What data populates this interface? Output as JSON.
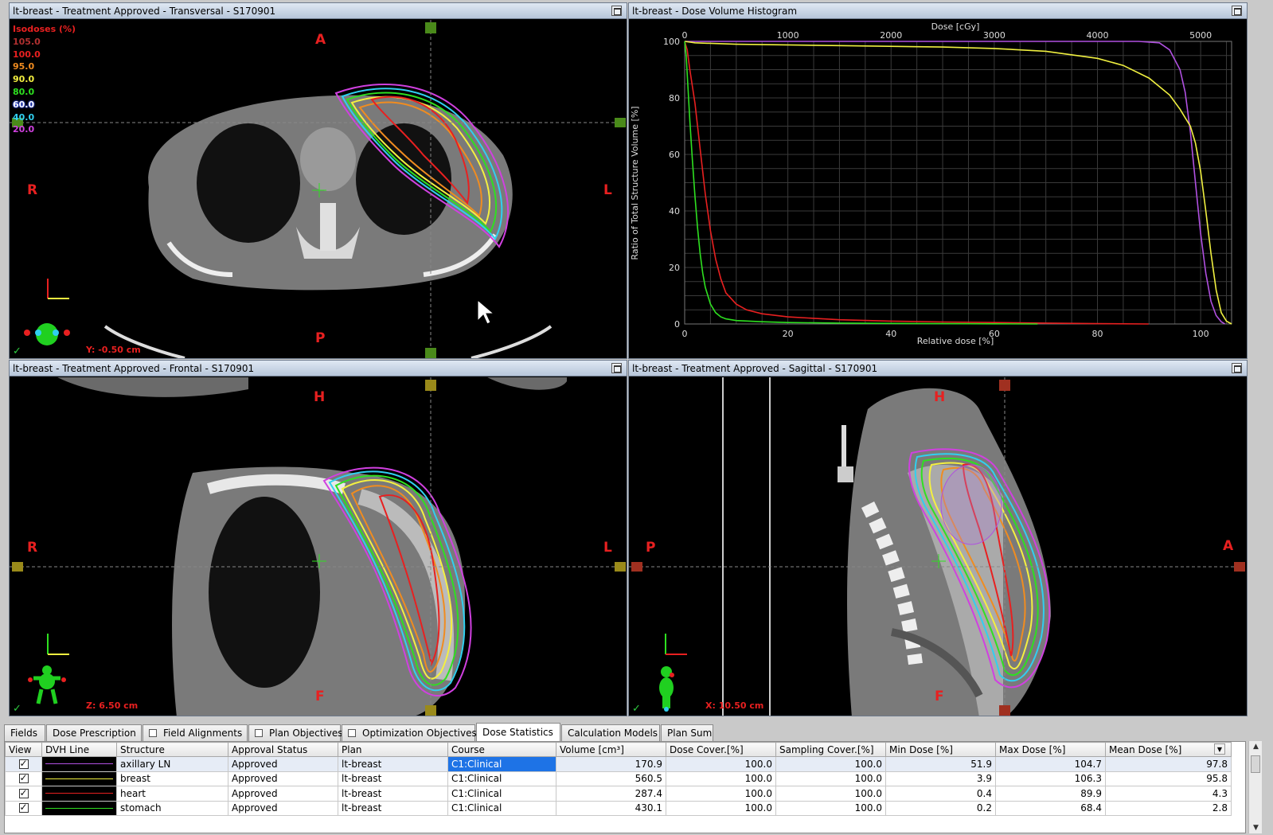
{
  "panes": {
    "transversal": {
      "title": "lt-breast - Treatment Approved - Transversal - S170901",
      "coord": "Y: -0.50 cm",
      "orient": {
        "top": "A",
        "bottom": "P",
        "left": "R",
        "right": "L"
      }
    },
    "dvh": {
      "title": "lt-breast - Dose Volume Histogram"
    },
    "frontal": {
      "title": "lt-breast - Treatment Approved - Frontal - S170901",
      "coord": "Z: 6.50 cm",
      "orient": {
        "top": "H",
        "bottom": "F",
        "left": "R",
        "right": "L"
      }
    },
    "sagittal": {
      "title": "lt-breast - Treatment Approved - Sagittal - S170901",
      "coord": "X: 10.50 cm",
      "orient": {
        "top": "H",
        "bottom": "F",
        "left": "P",
        "right": "A"
      }
    }
  },
  "isodoses": {
    "title": "Isodoses (%)",
    "levels": [
      {
        "label": "105.0",
        "color": "#b03030"
      },
      {
        "label": "100.0",
        "color": "#e82020"
      },
      {
        "label": "95.0",
        "color": "#f08c20"
      },
      {
        "label": "90.0",
        "color": "#f4f040"
      },
      {
        "label": "80.0",
        "color": "#2ee020"
      },
      {
        "label": "60.0",
        "color": "#ffffff"
      },
      {
        "label": "40.0",
        "color": "#30d0f0"
      },
      {
        "label": "20.0",
        "color": "#d040e0"
      }
    ]
  },
  "chart_data": {
    "type": "line",
    "title": "",
    "x_top_label": "Dose [cGy]",
    "x_top_ticks": [
      0,
      1000,
      2000,
      3000,
      4000,
      5000
    ],
    "x_top_range": [
      0,
      5300
    ],
    "xlabel": "Relative dose [%]",
    "xlim": [
      0,
      106
    ],
    "x_ticks": [
      0,
      20,
      40,
      60,
      80,
      100
    ],
    "ylabel": "Ratio of Total Structure Volume [%]",
    "ylim": [
      0,
      100
    ],
    "y_ticks": [
      0,
      20,
      40,
      60,
      80,
      100
    ],
    "grid": true,
    "series": [
      {
        "color": "#b050e0",
        "x": [
          0,
          80,
          88,
          92,
          94,
          96,
          97,
          98,
          99,
          100,
          101,
          102,
          103,
          104,
          104.7
        ],
        "y": [
          100,
          100,
          100,
          99.5,
          97,
          90,
          82,
          68,
          50,
          32,
          18,
          8,
          3,
          0.8,
          0
        ]
      },
      {
        "color": "#f0f040",
        "x": [
          0,
          2,
          10,
          30,
          50,
          60,
          70,
          80,
          85,
          90,
          94,
          96,
          97,
          98,
          99,
          100,
          101,
          102,
          103,
          104,
          105,
          106
        ],
        "y": [
          100,
          99.5,
          99,
          98.5,
          98,
          97.5,
          96.5,
          94,
          91.5,
          87,
          81,
          76,
          73,
          70,
          64,
          54,
          40,
          25,
          12,
          4,
          1,
          0
        ]
      },
      {
        "color": "#e82020",
        "x": [
          0,
          0.5,
          1,
          2,
          3,
          4,
          5,
          6,
          7,
          8,
          10,
          12,
          15,
          20,
          30,
          40,
          50,
          60,
          70,
          80,
          89.9
        ],
        "y": [
          100,
          97,
          90,
          78,
          62,
          46,
          33,
          23,
          16,
          11,
          7,
          5,
          3.6,
          2.5,
          1.5,
          1,
          0.7,
          0.5,
          0.3,
          0.1,
          0
        ]
      },
      {
        "color": "#2ee020",
        "x": [
          0,
          0.3,
          0.6,
          1,
          1.5,
          2,
          2.5,
          3,
          3.5,
          4,
          5,
          6,
          7,
          8,
          10,
          15,
          20,
          30,
          40,
          50,
          60,
          68.4
        ],
        "y": [
          100,
          95,
          85,
          72,
          58,
          45,
          34,
          25,
          18,
          13,
          7,
          4,
          2.5,
          1.8,
          1.2,
          0.8,
          0.5,
          0.3,
          0.2,
          0.1,
          0.05,
          0
        ]
      }
    ]
  },
  "tabs": [
    {
      "label": "Fields",
      "checkbox": false,
      "active": false
    },
    {
      "label": "Dose Prescription",
      "checkbox": false,
      "active": false
    },
    {
      "label": "Field Alignments",
      "checkbox": true,
      "active": false
    },
    {
      "label": "Plan Objectives",
      "checkbox": true,
      "active": false
    },
    {
      "label": "Optimization Objectives",
      "checkbox": true,
      "active": false
    },
    {
      "label": "Dose Statistics",
      "checkbox": false,
      "active": true
    },
    {
      "label": "Calculation Models",
      "checkbox": false,
      "active": false
    },
    {
      "label": "Plan Sum",
      "checkbox": false,
      "active": false
    }
  ],
  "table": {
    "headers": [
      "View",
      "DVH Line",
      "Structure",
      "Approval Status",
      "Plan",
      "Course",
      "Volume [cm³]",
      "Dose Cover.[%]",
      "Sampling Cover.[%]",
      "Min Dose [%]",
      "Max Dose [%]",
      "Mean Dose [%]"
    ],
    "rows": [
      {
        "line_color": "#b050e0",
        "structure": "axillary LN",
        "approval": "Approved",
        "plan": "lt-breast",
        "course": "C1:Clinical",
        "volume": "170.9",
        "dose_cover": "100.0",
        "sampling_cover": "100.0",
        "min": "51.9",
        "max": "104.7",
        "mean": "97.8"
      },
      {
        "line_color": "#f0f040",
        "structure": "breast",
        "approval": "Approved",
        "plan": "lt-breast",
        "course": "C1:Clinical",
        "volume": "560.5",
        "dose_cover": "100.0",
        "sampling_cover": "100.0",
        "min": "3.9",
        "max": "106.3",
        "mean": "95.8"
      },
      {
        "line_color": "#e82020",
        "structure": "heart",
        "approval": "Approved",
        "plan": "lt-breast",
        "course": "C1:Clinical",
        "volume": "287.4",
        "dose_cover": "100.0",
        "sampling_cover": "100.0",
        "min": "0.4",
        "max": "89.9",
        "mean": "4.3"
      },
      {
        "line_color": "#2ee020",
        "structure": "stomach",
        "approval": "Approved",
        "plan": "lt-breast",
        "course": "C1:Clinical",
        "volume": "430.1",
        "dose_cover": "100.0",
        "sampling_cover": "100.0",
        "min": "0.2",
        "max": "68.4",
        "mean": "2.8"
      }
    ]
  }
}
